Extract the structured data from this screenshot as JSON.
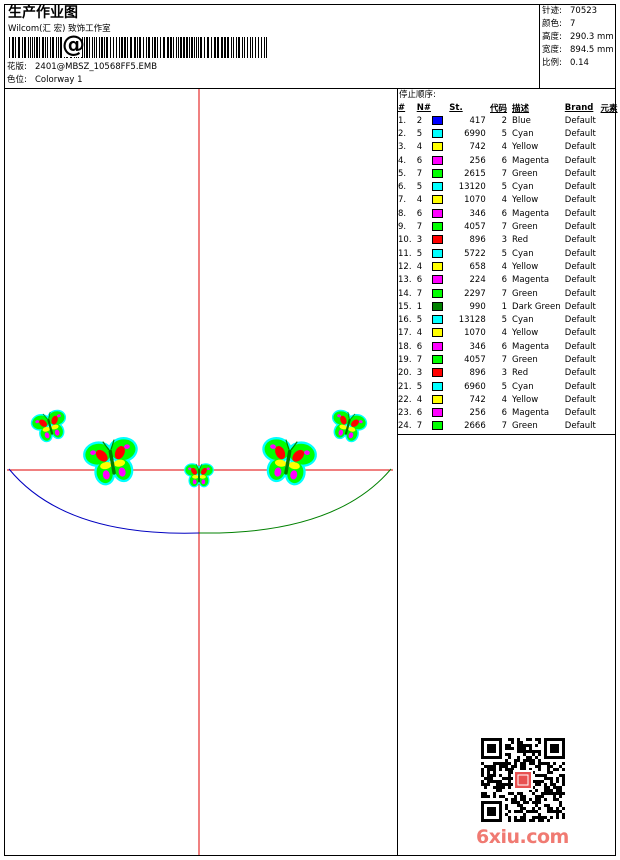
{
  "header": {
    "title": "生产作业图",
    "company": "Wilcom(汇 宏) 致饰工作室",
    "pattern_label": "花版:",
    "pattern_value": "2401@MBSZ_10568FF5.EMB",
    "color_label": "色位:",
    "color_value": "Colorway 1",
    "barcode_symbol": "@"
  },
  "stats": {
    "stitches_label": "针迹:",
    "stitches": "70523",
    "colors_label": "颜色:",
    "colors": "7",
    "height_label": "高度:",
    "height": "290.3 mm",
    "width_label": "宽度:",
    "width": "894.5 mm",
    "scale_label": "比例:",
    "scale": "0.14"
  },
  "sequence": {
    "title": "停止顺序:",
    "headers": {
      "idx": "#",
      "n": "N#",
      "st": "St.",
      "code": "代码",
      "desc": "描述",
      "brand": "Brand",
      "elem": "元素"
    },
    "colors": {
      "Blue": "#0000ff",
      "Cyan": "#00ffff",
      "Yellow": "#ffff00",
      "Magenta": "#ff00ff",
      "Green": "#00ff00",
      "Red": "#ff0000",
      "Dark Green": "#008000"
    },
    "rows": [
      {
        "idx": "1.",
        "n": "2",
        "st": "417",
        "code": "2",
        "desc": "Blue",
        "brand": "Default"
      },
      {
        "idx": "2.",
        "n": "5",
        "st": "6990",
        "code": "5",
        "desc": "Cyan",
        "brand": "Default"
      },
      {
        "idx": "3.",
        "n": "4",
        "st": "742",
        "code": "4",
        "desc": "Yellow",
        "brand": "Default"
      },
      {
        "idx": "4.",
        "n": "6",
        "st": "256",
        "code": "6",
        "desc": "Magenta",
        "brand": "Default"
      },
      {
        "idx": "5.",
        "n": "7",
        "st": "2615",
        "code": "7",
        "desc": "Green",
        "brand": "Default"
      },
      {
        "idx": "6.",
        "n": "5",
        "st": "13120",
        "code": "5",
        "desc": "Cyan",
        "brand": "Default"
      },
      {
        "idx": "7.",
        "n": "4",
        "st": "1070",
        "code": "4",
        "desc": "Yellow",
        "brand": "Default"
      },
      {
        "idx": "8.",
        "n": "6",
        "st": "346",
        "code": "6",
        "desc": "Magenta",
        "brand": "Default"
      },
      {
        "idx": "9.",
        "n": "7",
        "st": "4057",
        "code": "7",
        "desc": "Green",
        "brand": "Default"
      },
      {
        "idx": "10.",
        "n": "3",
        "st": "896",
        "code": "3",
        "desc": "Red",
        "brand": "Default"
      },
      {
        "idx": "11.",
        "n": "5",
        "st": "5722",
        "code": "5",
        "desc": "Cyan",
        "brand": "Default"
      },
      {
        "idx": "12.",
        "n": "4",
        "st": "658",
        "code": "4",
        "desc": "Yellow",
        "brand": "Default"
      },
      {
        "idx": "13.",
        "n": "6",
        "st": "224",
        "code": "6",
        "desc": "Magenta",
        "brand": "Default"
      },
      {
        "idx": "14.",
        "n": "7",
        "st": "2297",
        "code": "7",
        "desc": "Green",
        "brand": "Default"
      },
      {
        "idx": "15.",
        "n": "1",
        "st": "990",
        "code": "1",
        "desc": "Dark Green",
        "brand": "Default"
      },
      {
        "idx": "16.",
        "n": "5",
        "st": "13128",
        "code": "5",
        "desc": "Cyan",
        "brand": "Default"
      },
      {
        "idx": "17.",
        "n": "4",
        "st": "1070",
        "code": "4",
        "desc": "Yellow",
        "brand": "Default"
      },
      {
        "idx": "18.",
        "n": "6",
        "st": "346",
        "code": "6",
        "desc": "Magenta",
        "brand": "Default"
      },
      {
        "idx": "19.",
        "n": "7",
        "st": "4057",
        "code": "7",
        "desc": "Green",
        "brand": "Default"
      },
      {
        "idx": "20.",
        "n": "3",
        "st": "896",
        "code": "3",
        "desc": "Red",
        "brand": "Default"
      },
      {
        "idx": "21.",
        "n": "5",
        "st": "6960",
        "code": "5",
        "desc": "Cyan",
        "brand": "Default"
      },
      {
        "idx": "22.",
        "n": "4",
        "st": "742",
        "code": "4",
        "desc": "Yellow",
        "brand": "Default"
      },
      {
        "idx": "23.",
        "n": "6",
        "st": "256",
        "code": "6",
        "desc": "Magenta",
        "brand": "Default"
      },
      {
        "idx": "24.",
        "n": "7",
        "st": "2666",
        "code": "7",
        "desc": "Green",
        "brand": "Default"
      }
    ]
  },
  "design": {
    "axis_color": "#e00000",
    "arc_left_color": "#0000c0",
    "arc_right_color": "#008000",
    "butterfly_colors": [
      "#00ff00",
      "#00ffff",
      "#ffff00",
      "#ff00ff",
      "#ff0000",
      "#008000"
    ]
  },
  "watermark": {
    "text": "6xiu.com",
    "color": "#f07a72",
    "icon": "qr-code-icon"
  }
}
